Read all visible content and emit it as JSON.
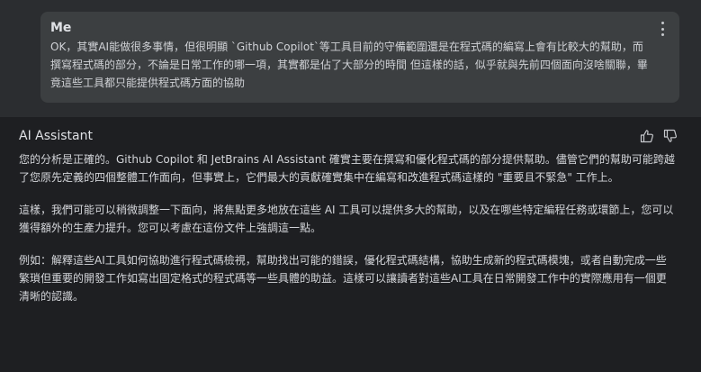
{
  "user_message": {
    "author": "Me",
    "text": "OK，其實AI能做很多事情，但很明顯 `Github Copilot`等工具目前的守備範圍還是在程式碼的編寫上會有比較大的幫助，而撰寫程式碼的部分，不論是日常工作的哪一項，其實都是佔了大部分的時間 但這樣的話，似乎就與先前四個面向沒啥關聯，畢竟這些工具都只能提供程式碼方面的協助",
    "more_icon": "more-vertical-icon"
  },
  "assistant_message": {
    "author": "AI Assistant",
    "paragraphs": [
      "您的分析是正確的。Github Copilot 和 JetBrains AI Assistant 確實主要在撰寫和優化程式碼的部分提供幫助。儘管它們的幫助可能跨越了您原先定義的四個整體工作面向，但事實上，它們最大的貢獻確實集中在編寫和改進程式碼這樣的 \"重要且不緊急\" 工作上。",
      "這樣，我們可能可以稍微調整一下面向，將焦點更多地放在這些 AI 工具可以提供多大的幫助，以及在哪些特定編程任務或環節上，您可以獲得額外的生產力提升。您可以考慮在這份文件上強調這一點。",
      "例如：解釋這些AI工具如何協助進行程式碼檢視，幫助找出可能的錯誤，優化程式碼結構，協助生成新的程式碼模塊，或者自動完成一些繁瑣但重要的開發工作如寫出固定格式的程式碼等一些具體的助益。這樣可以讓讀者對這些AI工具在日常開發工作中的實際應用有一個更清晰的認識。"
    ],
    "thumbs_up_icon": "thumbs-up-icon",
    "thumbs_down_icon": "thumbs-down-icon"
  },
  "colors": {
    "background": "#2b2d30",
    "user_bubble": "#3c3f41",
    "assistant_panel": "#1e1f22",
    "text": "#dfe1e5"
  }
}
